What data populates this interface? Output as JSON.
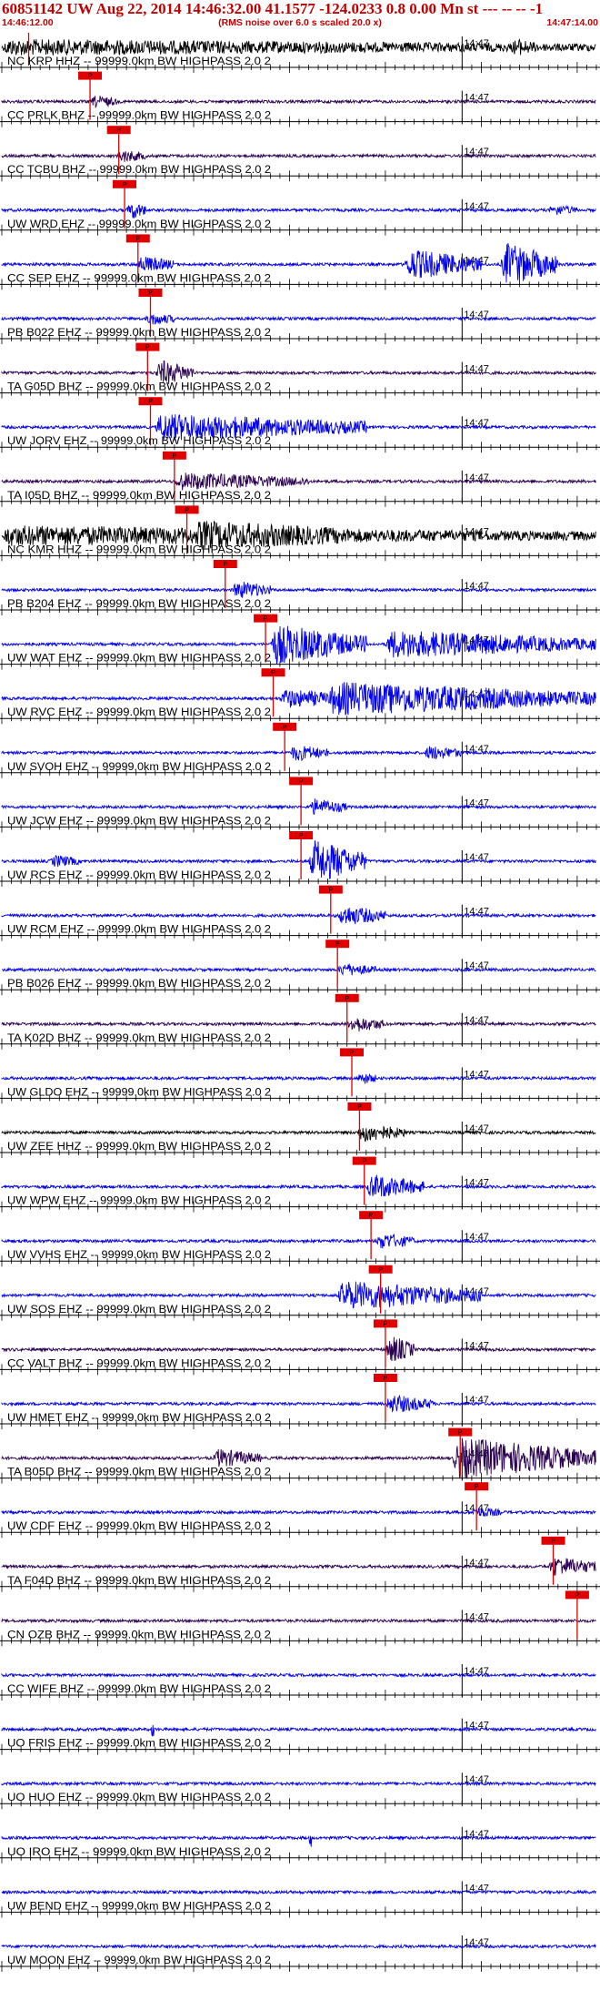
{
  "header": {
    "title": "60851142 UW Aug 22, 2014 14:46:32.00   41.1577 -124.0233  0.8 0.00 Mn st --- -- --   -1",
    "start_time": "14:46:12.00",
    "rms_note": "(RMS noise over 6.0 s scaled 20.0 x)",
    "end_time": "14:47:14.00"
  },
  "colors": {
    "title": "#c00000",
    "pick": "#e00000",
    "blue": "#0000ee",
    "dark": "#2a0050",
    "black": "#000000"
  },
  "chart_data": {
    "type": "line",
    "title": "60851142 UW Aug 22, 2014 14:46:32.00   41.1577 -124.0233  0.8 0.00 Mn st --- -- --   -1",
    "time_range": [
      "14:46:12.00",
      "14:47:14.00"
    ],
    "minute_tick_label": "14:47",
    "pick_label": "P",
    "traces": [
      {
        "label": "NC KRP HHZ -- 99999.0km BW  HIGHPASS  2.0  2",
        "color": "black",
        "pick_s": 2.8,
        "bursts": [
          [
            0,
            62,
            0.7
          ],
          [
            53,
            56,
            0.9
          ]
        ]
      },
      {
        "label": "CC PRLK BHZ -- 99999.0km BW  HIGHPASS  2.0  2",
        "color": "dark",
        "pick_s": 9.2,
        "bursts": [
          [
            9.2,
            12,
            0.6
          ]
        ]
      },
      {
        "label": "CC TCBU BHZ -- 99999.0km BW  HIGHPASS  2.0  2",
        "color": "dark",
        "pick_s": 12.2,
        "bursts": [
          [
            12,
            15,
            0.6
          ]
        ]
      },
      {
        "label": "UW WRD EHZ -- 99999.0km BW  HIGHPASS  2.0  2",
        "color": "blue",
        "pick_s": 12.8,
        "bursts": [
          [
            13,
            15,
            1.0
          ],
          [
            57,
            60,
            0.5
          ]
        ]
      },
      {
        "label": "CC SEP EHZ -- 99999.0km BW  HIGHPASS  2.0  2",
        "color": "blue",
        "pick_s": 14.2,
        "bursts": [
          [
            14,
            18,
            0.8
          ],
          [
            42,
            50,
            1.5
          ],
          [
            52,
            58,
            2.2
          ]
        ]
      },
      {
        "label": "PB B022 EHZ -- 99999.0km BW  HIGHPASS  2.0  2",
        "color": "blue",
        "pick_s": 15.5,
        "bursts": [
          [
            15,
            18,
            0.6
          ]
        ]
      },
      {
        "label": "TA G05D BHZ -- 99999.0km BW  HIGHPASS  2.0  2",
        "color": "dark",
        "pick_s": 15.2,
        "bursts": [
          [
            16,
            20,
            1.3
          ]
        ]
      },
      {
        "label": "UW JORV EHZ -- 99999.0km BW  HIGHPASS  2.0  2",
        "color": "blue",
        "pick_s": 15.5,
        "bursts": [
          [
            16,
            38,
            1.3
          ]
        ]
      },
      {
        "label": "TA I05D BHZ -- 99999.0km BW  HIGHPASS  2.0  2",
        "color": "dark",
        "pick_s": 18.0,
        "bursts": [
          [
            18,
            32,
            0.8
          ]
        ]
      },
      {
        "label": "NC KMR HHZ -- 99999.0km BW  HIGHPASS  2.0  2",
        "color": "black",
        "pick_s": 19.3,
        "bursts": [
          [
            0,
            62,
            0.9
          ],
          [
            20,
            40,
            1.4
          ]
        ]
      },
      {
        "label": "PB B204 EHZ -- 99999.0km BW  HIGHPASS  2.0  2",
        "color": "blue",
        "pick_s": 23.3,
        "bursts": [
          [
            24,
            28,
            0.9
          ]
        ]
      },
      {
        "label": "UW WAT EHZ -- 99999.0km BW  HIGHPASS  2.0  2",
        "color": "blue",
        "pick_s": 27.5,
        "bursts": [
          [
            28,
            38,
            2.0
          ],
          [
            40,
            62,
            1.3
          ]
        ]
      },
      {
        "label": "UW RVC EHZ -- 99999.0km BW  HIGHPASS  2.0  2",
        "color": "blue",
        "pick_s": 28.3,
        "bursts": [
          [
            29,
            36,
            0.9
          ],
          [
            34,
            62,
            1.6
          ]
        ]
      },
      {
        "label": "UW SVOH EHZ -- 99999.0km BW  HIGHPASS  2.0  2",
        "color": "blue",
        "pick_s": 29.5,
        "bursts": [
          [
            30,
            34,
            0.8
          ],
          [
            44,
            48,
            0.7
          ]
        ]
      },
      {
        "label": "UW JCW EHZ -- 99999.0km BW  HIGHPASS  2.0  2",
        "color": "blue",
        "pick_s": 31.2,
        "bursts": [
          [
            32,
            36,
            0.8
          ]
        ]
      },
      {
        "label": "UW RCS EHZ -- 99999.0km BW  HIGHPASS  2.0  2",
        "color": "blue",
        "pick_s": 31.2,
        "bursts": [
          [
            32,
            38,
            2.2
          ],
          [
            5,
            8,
            0.6
          ]
        ]
      },
      {
        "label": "UW RCM EHZ -- 99999.0km BW  HIGHPASS  2.0  2",
        "color": "blue",
        "pick_s": 34.3,
        "bursts": [
          [
            35,
            40,
            1.0
          ]
        ]
      },
      {
        "label": "PB B026 EHZ -- 99999.0km BW  HIGHPASS  2.0  2",
        "color": "blue",
        "pick_s": 35.0,
        "bursts": [
          [
            35,
            39,
            0.6
          ]
        ]
      },
      {
        "label": "TA K02D BHZ -- 99999.0km BW  HIGHPASS  2.0  2",
        "color": "dark",
        "pick_s": 36.0,
        "bursts": [
          [
            36,
            40,
            0.8
          ]
        ]
      },
      {
        "label": "UW GLDO EHZ -- 99999.0km BW  HIGHPASS  2.0  2",
        "color": "blue",
        "pick_s": 36.5,
        "bursts": [
          [
            37,
            39,
            0.6
          ]
        ]
      },
      {
        "label": "UW ZEE HHZ -- 99999.0km BW  HIGHPASS  2.0  2",
        "color": "black",
        "pick_s": 37.3,
        "bursts": [
          [
            37,
            42,
            0.9
          ]
        ]
      },
      {
        "label": "UW WPW EHZ -- 99999.0km BW  HIGHPASS  2.0  2",
        "color": "blue",
        "pick_s": 37.8,
        "bursts": [
          [
            38,
            44,
            1.2
          ]
        ]
      },
      {
        "label": "UW VVHS EHZ -- 99999.0km BW  HIGHPASS  2.0  2",
        "color": "blue",
        "pick_s": 38.5,
        "bursts": [
          [
            39,
            43,
            0.8
          ]
        ]
      },
      {
        "label": "UW SOS EHZ -- 99999.0km BW  HIGHPASS  2.0  2",
        "color": "blue",
        "pick_s": 39.5,
        "bursts": [
          [
            35,
            50,
            1.4
          ]
        ]
      },
      {
        "label": "CC VALT BHZ -- 99999.0km BW  HIGHPASS  2.0  2",
        "color": "dark",
        "pick_s": 40.0,
        "bursts": [
          [
            40,
            43,
            1.5
          ]
        ]
      },
      {
        "label": "UW HMET EHZ -- 99999.0km BW  HIGHPASS  2.0  2",
        "color": "blue",
        "pick_s": 40.0,
        "bursts": [
          [
            40,
            45,
            0.9
          ]
        ]
      },
      {
        "label": "TA B05D BHZ -- 99999.0km BW  HIGHPASS  2.0  2",
        "color": "dark",
        "pick_s": 47.8,
        "bursts": [
          [
            22,
            27,
            0.9
          ],
          [
            47,
            62,
            2.0
          ]
        ]
      },
      {
        "label": "UW CDF EHZ -- 99999.0km BW  HIGHPASS  2.0  2",
        "color": "blue",
        "pick_s": 49.5,
        "bursts": [
          [
            49,
            52,
            0.5
          ]
        ]
      },
      {
        "label": "TA F04D BHZ -- 99999.0km BW  HIGHPASS  2.0  2",
        "color": "dark",
        "pick_s": 57.5,
        "bursts": [
          [
            57,
            62,
            1.0
          ]
        ]
      },
      {
        "label": "CN OZB BHZ -- 99999.0km BW  HIGHPASS  2.0  2",
        "color": "dark",
        "pick_s": 60.0,
        "bursts": []
      },
      {
        "label": "CC WIFE BHZ -- 99999.0km BW  HIGHPASS  2.0  2",
        "color": "blue",
        "pick_s": null,
        "bursts": []
      },
      {
        "label": "UO FRIS EHZ -- 99999.0km BW  HIGHPASS  2.0  2",
        "color": "blue",
        "pick_s": null,
        "bursts": [
          [
            15.5,
            15.9,
            2.5
          ]
        ]
      },
      {
        "label": "UO HUO EHZ -- 99999.0km BW  HIGHPASS  2.0  2",
        "color": "blue",
        "pick_s": null,
        "bursts": []
      },
      {
        "label": "UO IRO EHZ -- 99999.0km BW  HIGHPASS  2.0  2",
        "color": "blue",
        "pick_s": null,
        "bursts": [
          [
            32,
            32.3,
            3.0
          ]
        ]
      },
      {
        "label": "UW BEND EHZ -- 99999.0km BW  HIGHPASS  2.0  2",
        "color": "blue",
        "pick_s": null,
        "bursts": []
      },
      {
        "label": "UW MOON EHZ -- 99999.0km BW  HIGHPASS  2.0  2",
        "color": "blue",
        "pick_s": null,
        "bursts": []
      }
    ]
  }
}
